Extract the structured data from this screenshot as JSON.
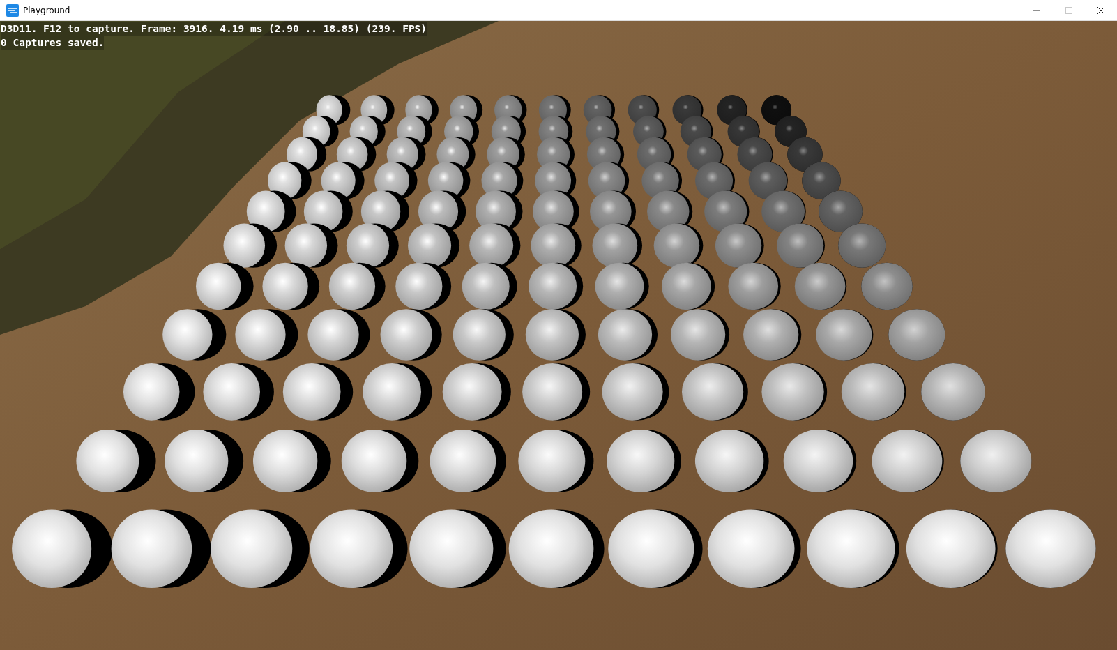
{
  "window": {
    "title": "Playground",
    "maximize_disabled": true
  },
  "overlay": {
    "lines": [
      "D3D11. F12 to capture. Frame: 3916. 4.19 ms (2.90 .. 18.85) (239. FPS)",
      "0 Captures saved."
    ]
  }
}
